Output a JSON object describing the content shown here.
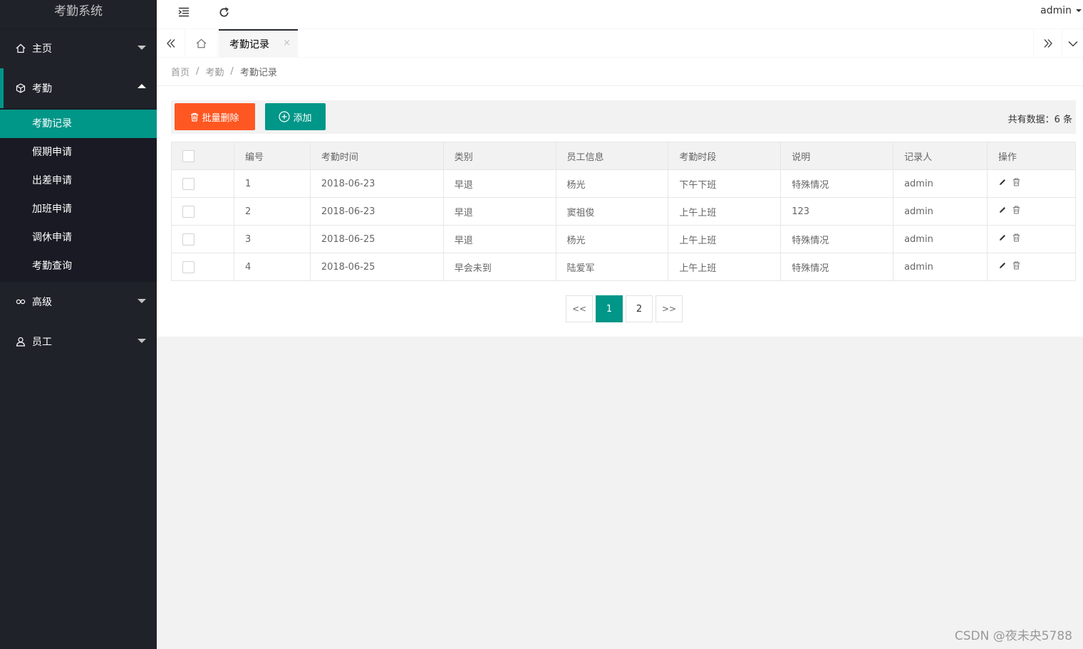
{
  "app": {
    "title": "考勤系统"
  },
  "header": {
    "user": "admin"
  },
  "sidebar": {
    "groups": [
      {
        "label": "主页",
        "expanded": false
      },
      {
        "label": "考勤",
        "expanded": true,
        "items": [
          "考勤记录",
          "假期申请",
          "出差申请",
          "加班申请",
          "调休申请",
          "考勤查询"
        ]
      },
      {
        "label": "高级",
        "expanded": false
      },
      {
        "label": "员工",
        "expanded": false
      }
    ],
    "active_item": "考勤记录"
  },
  "tabs": {
    "active": "考勤记录",
    "close": "×"
  },
  "breadcrumb": {
    "home": "首页",
    "section": "考勤",
    "current": "考勤记录",
    "sep": "/"
  },
  "toolbar": {
    "batch_delete": "批量删除",
    "add": "添加",
    "total": "共有数据：6 条"
  },
  "table": {
    "headers": [
      "编号",
      "考勤时间",
      "类别",
      "员工信息",
      "考勤时段",
      "说明",
      "记录人",
      "操作"
    ],
    "rows": [
      [
        "1",
        "2018-06-23",
        "早退",
        "杨光",
        "下午下班",
        "特殊情况",
        "admin"
      ],
      [
        "2",
        "2018-06-23",
        "早退",
        "窦祖俊",
        "上午上班",
        "123",
        "admin"
      ],
      [
        "3",
        "2018-06-25",
        "早退",
        "杨光",
        "上午上班",
        "特殊情况",
        "admin"
      ],
      [
        "4",
        "2018-06-25",
        "早会未到",
        "陆爱军",
        "上午上班",
        "特殊情况",
        "admin"
      ]
    ]
  },
  "pager": {
    "prev": "<<",
    "pages": [
      "1",
      "2"
    ],
    "next": ">>",
    "current": "1"
  },
  "watermark": "CSDN @夜未央5788",
  "colors": {
    "accent": "#009688",
    "danger": "#ff5722",
    "sidebar": "#20222a"
  }
}
